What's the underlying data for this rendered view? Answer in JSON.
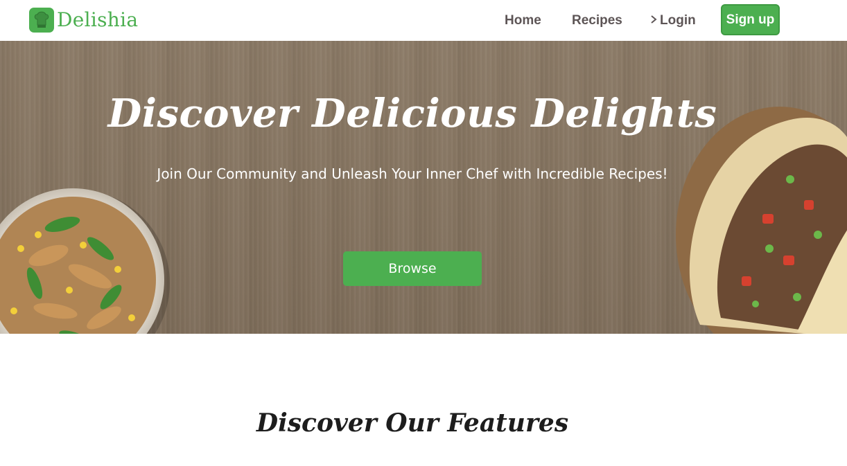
{
  "nav": {
    "brand": "Delishia",
    "links": {
      "home": "Home",
      "recipes": "Recipes",
      "login": "Login"
    },
    "signup": "Sign up"
  },
  "hero": {
    "title": "Discover Delicious Delights",
    "subtitle": "Join Our Community and Unleash Your Inner Chef with Incredible Recipes!",
    "cta": "Browse"
  },
  "features": {
    "title": "Discover Our Features"
  },
  "icons": {
    "logo": "chef-hat-icon",
    "login": "chevron-right-icon"
  },
  "colors": {
    "accent": "#4caf50",
    "nav_text": "#5d5556",
    "hero_bg": "#857460"
  }
}
